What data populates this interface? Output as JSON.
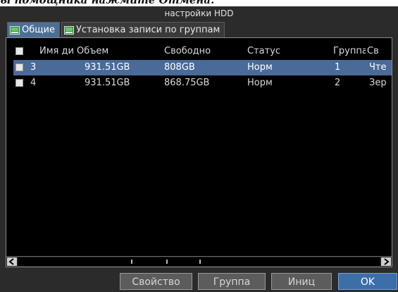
{
  "top_caption": "ы помощника нажмите Отмена.",
  "window": {
    "title": "настройки HDD"
  },
  "tabs": [
    {
      "label": "Общие",
      "active": true
    },
    {
      "label": "Установка записи по группам",
      "active": false
    }
  ],
  "table": {
    "columns": [
      "Имя ди",
      "Объем",
      "Свободно",
      "Статус",
      "Группа",
      "Св"
    ],
    "rows": [
      {
        "name": "3",
        "capacity": "931.51GB",
        "free": "808GB",
        "status": "Норм",
        "group": "1",
        "property": "Чте",
        "selected": true
      },
      {
        "name": "4",
        "capacity": "931.51GB",
        "free": "868.75GB",
        "status": "Норм",
        "group": "2",
        "property": "Зер",
        "selected": false
      }
    ]
  },
  "scrollbar": {
    "left_icon": "chevron-left-icon",
    "right_icon": "chevron-right-icon"
  },
  "buttons": {
    "property": "Свойство",
    "group": "Группа",
    "init": "Иниц",
    "ok": "OK"
  },
  "colors": {
    "window_bg": "#2b2b2b",
    "selection": "#4a6a98",
    "accent": "#3d6ea8"
  }
}
